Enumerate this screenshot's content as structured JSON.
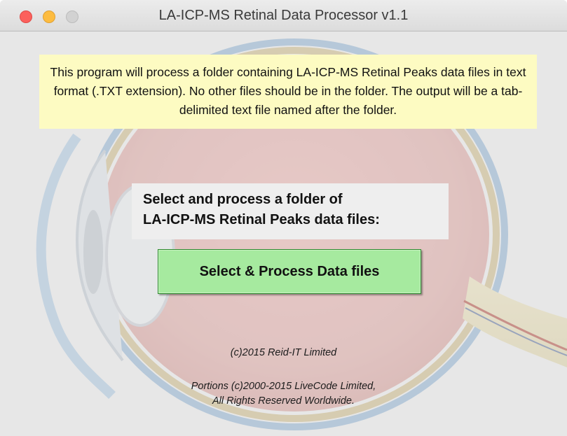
{
  "window": {
    "title": "LA-ICP-MS Retinal Data Processor v1.1"
  },
  "info": {
    "text": "This program will process a folder containing LA-ICP-MS Retinal Peaks data files in text format (.TXT extension).  No other files should be in the folder. The output will be a tab-delimited text file named after the folder."
  },
  "prompt": {
    "line1": "Select and process a folder of",
    "line2": "LA-ICP-MS Retinal Peaks data files:"
  },
  "button": {
    "label": "Select & Process Data files"
  },
  "credits": {
    "company": "(c)2015 Reid-IT Limited",
    "livecode_line1": "Portions (c)2000-2015 LiveCode Limited,",
    "livecode_line2": "All Rights Reserved Worldwide."
  },
  "icons": {
    "close": "close-window-icon",
    "minimize": "minimize-window-icon",
    "zoom": "zoom-window-icon",
    "background": "eye-anatomy-illustration"
  },
  "colors": {
    "info_background": "#fdfbc2",
    "button_background": "#a6ea9f",
    "close": "#fc605c",
    "minimize": "#fdbc40",
    "zoom_disabled": "#d2d2d2"
  }
}
